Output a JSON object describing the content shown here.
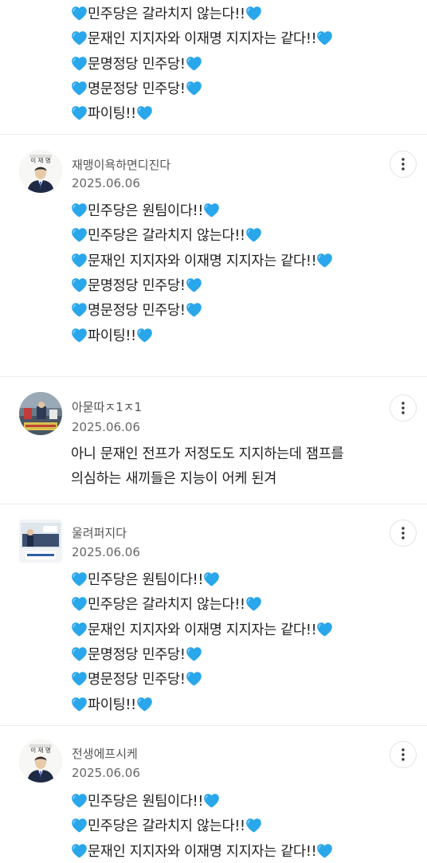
{
  "feed": {
    "top_partial": {
      "lines": [
        "민주당은 갈라치지 않는다!!",
        "문재인 지지자와 이재명 지지자는 같다!!",
        "문명정당 민주당!",
        "명문정당 민주당!",
        "파이팅!!"
      ]
    },
    "comments": [
      {
        "username": "재맹이욕하면디진다",
        "date": "2025.06.06",
        "avatar_caption": "이 재 명",
        "lines": [
          "민주당은 원팀이다!!",
          "민주당은 갈라치지 않는다!!",
          "문재인 지지자와 이재명 지지자는 같다!!",
          "문명정당 민주당!",
          "명문정당 민주당!",
          "파이팅!!"
        ]
      },
      {
        "username": "아묻따ㅈ1ㅈ1",
        "date": "2025.06.06",
        "text_lines": [
          "아니 문재인 전프가 저정도도 지지하는데 잼프를",
          "의심하는 새끼들은 지능이 어케 된겨"
        ]
      },
      {
        "username": "울려퍼지다",
        "date": "2025.06.06",
        "lines": [
          "민주당은 원팀이다!!",
          "민주당은 갈라치지 않는다!!",
          "문재인 지지자와 이재명 지지자는 같다!!",
          "문명정당 민주당!",
          "명문정당 민주당!",
          "파이팅!!"
        ]
      },
      {
        "username": "전생에프시케",
        "date": "2025.06.06",
        "avatar_caption": "이 재 명",
        "lines": [
          "민주당은 원팀이다!!",
          "민주당은 갈라치지 않는다!!",
          "문재인 지지자와 이재명 지지자는 같다!!"
        ]
      }
    ]
  },
  "colors": {
    "heart": "#2aa6ea",
    "divider": "#ececec",
    "text": "#1f1f1f",
    "meta": "#666666"
  },
  "icons": {
    "heart": "blue-heart-icon",
    "more": "more-vertical-icon"
  }
}
